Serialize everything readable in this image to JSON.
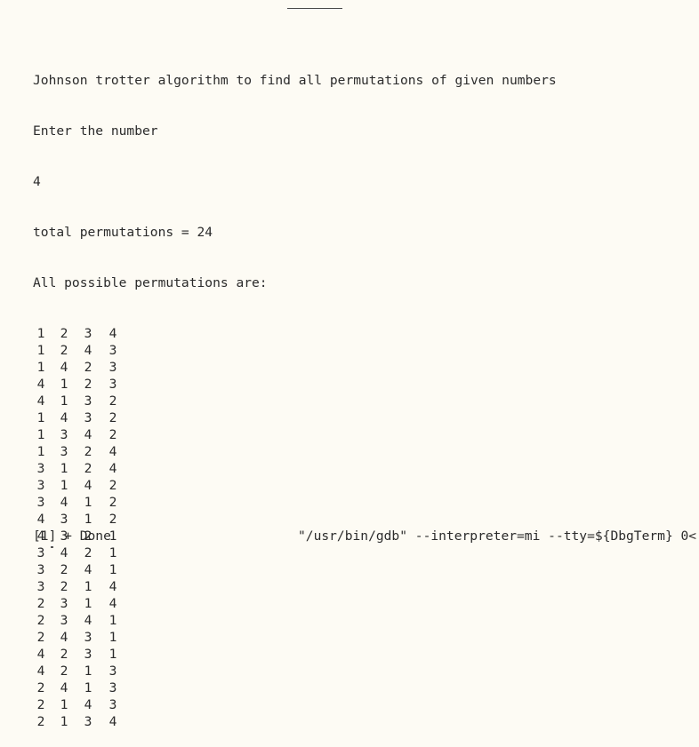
{
  "terminal": {
    "lines": [
      "Johnson trotter algorithm to find all permutations of given numbers",
      "Enter the number",
      "4",
      "total permutations = 24",
      "All possible permutations are:"
    ],
    "permutations": [
      [
        "1",
        "2",
        "3",
        "4"
      ],
      [
        "1",
        "2",
        "4",
        "3"
      ],
      [
        "1",
        "4",
        "2",
        "3"
      ],
      [
        "4",
        "1",
        "2",
        "3"
      ],
      [
        "4",
        "1",
        "3",
        "2"
      ],
      [
        "1",
        "4",
        "3",
        "2"
      ],
      [
        "1",
        "3",
        "4",
        "2"
      ],
      [
        "1",
        "3",
        "2",
        "4"
      ],
      [
        "3",
        "1",
        "2",
        "4"
      ],
      [
        "3",
        "1",
        "4",
        "2"
      ],
      [
        "3",
        "4",
        "1",
        "2"
      ],
      [
        "4",
        "3",
        "1",
        "2"
      ],
      [
        "4",
        "3",
        "2",
        "1"
      ],
      [
        "3",
        "4",
        "2",
        "1"
      ],
      [
        "3",
        "2",
        "4",
        "1"
      ],
      [
        "3",
        "2",
        "1",
        "4"
      ],
      [
        "2",
        "3",
        "1",
        "4"
      ],
      [
        "2",
        "3",
        "4",
        "1"
      ],
      [
        "2",
        "4",
        "3",
        "1"
      ],
      [
        "4",
        "2",
        "3",
        "1"
      ],
      [
        "4",
        "2",
        "1",
        "3"
      ],
      [
        "2",
        "4",
        "1",
        "3"
      ],
      [
        "2",
        "1",
        "4",
        "3"
      ],
      [
        "2",
        "1",
        "3",
        "4"
      ]
    ],
    "status": {
      "job": "[1] + Done",
      "command": "\"/usr/bin/gdb\" --interpreter=mi --tty=${DbgTerm} 0<"
    }
  }
}
